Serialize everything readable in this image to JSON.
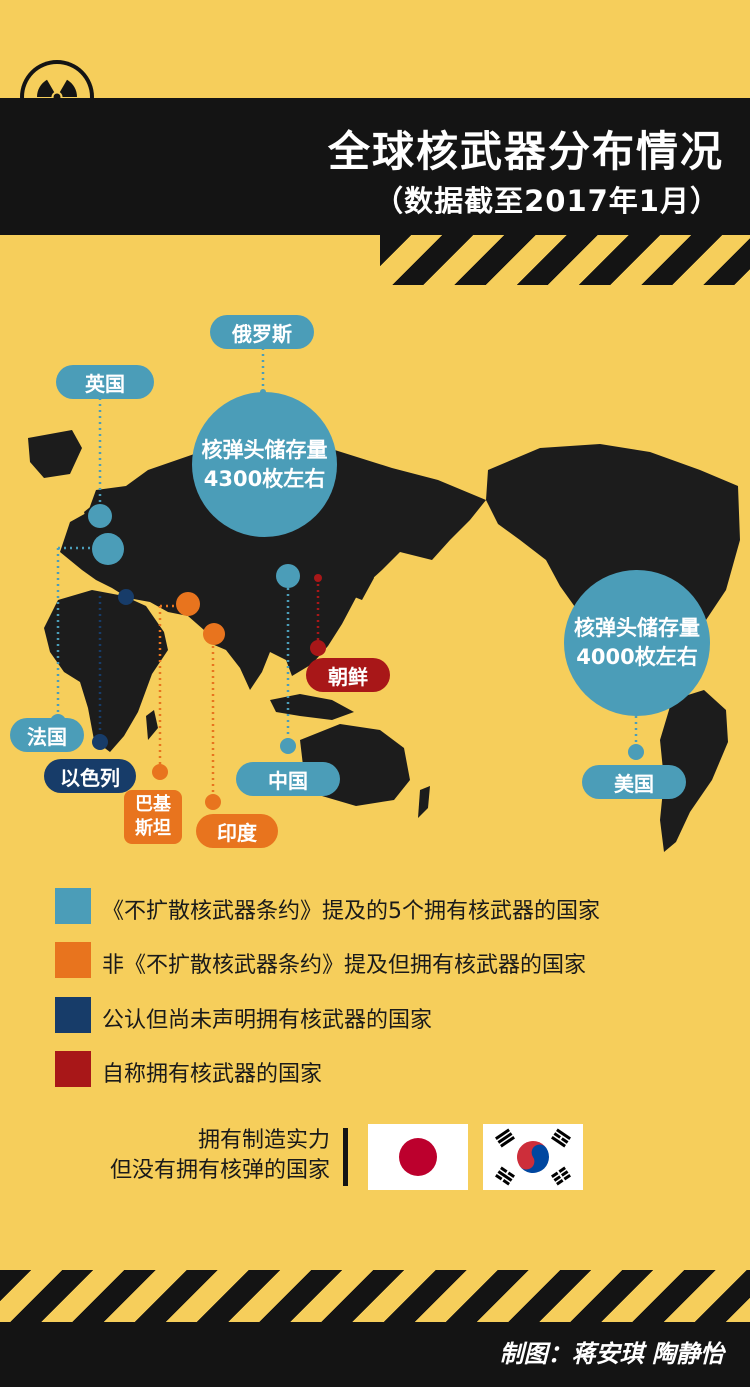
{
  "header": {
    "title": "全球核武器分布情况",
    "subtitle": "（数据截至2017年1月）"
  },
  "markers": {
    "russia": "俄罗斯",
    "uk": "英国",
    "france": "法国",
    "israel": "以色列",
    "pakistan_line1": "巴基",
    "pakistan_line2": "斯坦",
    "india": "印度",
    "china": "中国",
    "north_korea": "朝鲜",
    "usa": "美国"
  },
  "stockpiles": {
    "russia": {
      "line1": "核弹头储存量",
      "line2": "4300枚左右"
    },
    "usa": {
      "line1": "核弹头储存量",
      "line2": "4000枚左右"
    }
  },
  "legend": [
    {
      "text": "《不扩散核武器条约》提及的5个拥有核武器的国家",
      "color": "#4B9DB8"
    },
    {
      "text": "非《不扩散核武器条约》提及但拥有核武器的国家",
      "color": "#E8741E"
    },
    {
      "text": "公认但尚未声明拥有核武器的国家",
      "color": "#173C69"
    },
    {
      "text": "自称拥有核武器的国家",
      "color": "#A81718"
    }
  ],
  "capable": {
    "line1": "拥有制造实力",
    "line2": "但没有拥有核弹的国家",
    "flags": [
      "japan-flag",
      "south-korea-flag"
    ]
  },
  "footer": {
    "credit": "制图：蒋安琪 陶静怡"
  },
  "colors": {
    "background": "#F6CE5B",
    "dark": "#141414",
    "npt": "#4B9DB8",
    "non_npt": "#E8741E",
    "undeclared": "#173C69",
    "self_declared": "#A81718"
  }
}
